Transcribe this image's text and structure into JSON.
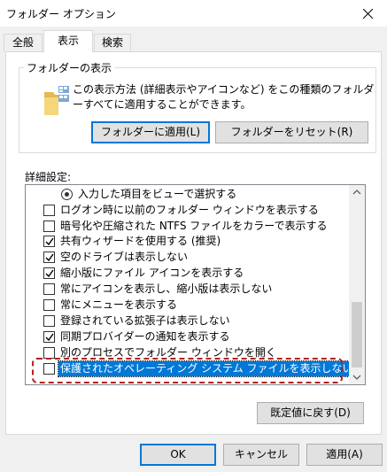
{
  "window": {
    "title": "フォルダー オプション",
    "close_glyph": "✕"
  },
  "tabs": [
    {
      "label": "全般",
      "active": false
    },
    {
      "label": "表示",
      "active": true
    },
    {
      "label": "検索",
      "active": false
    }
  ],
  "folder_view": {
    "legend": "フォルダーの表示",
    "description": "この表示方法 (詳細表示やアイコンなど) をこの種類のフォルダーすべてに適用することができます。",
    "apply_button": "フォルダーに適用(L)",
    "reset_button": "フォルダーをリセット(R)"
  },
  "advanced": {
    "label": "詳細設定:",
    "items": [
      {
        "type": "radio",
        "label": "入力した項目をビューで選択する",
        "checked": true
      },
      {
        "type": "checkbox",
        "label": "ログオン時に以前のフォルダー ウィンドウを表示する",
        "checked": false
      },
      {
        "type": "checkbox",
        "label": "暗号化や圧縮された NTFS ファイルをカラーで表示する",
        "checked": false
      },
      {
        "type": "checkbox",
        "label": "共有ウィザードを使用する (推奨)",
        "checked": true
      },
      {
        "type": "checkbox",
        "label": "空のドライブは表示しない",
        "checked": true
      },
      {
        "type": "checkbox",
        "label": "縮小版にファイル アイコンを表示する",
        "checked": true
      },
      {
        "type": "checkbox",
        "label": "常にアイコンを表示し、縮小版は表示しない",
        "checked": false
      },
      {
        "type": "checkbox",
        "label": "常にメニューを表示する",
        "checked": false
      },
      {
        "type": "checkbox",
        "label": "登録されている拡張子は表示しない",
        "checked": false
      },
      {
        "type": "checkbox",
        "label": "同期プロバイダーの通知を表示する",
        "checked": true
      },
      {
        "type": "checkbox",
        "label": "別のプロセスでフォルダー ウィンドウを開く",
        "checked": false
      },
      {
        "type": "checkbox",
        "label": "保護されたオペレーティング システム ファイルを表示しない (推奨)",
        "checked": false,
        "selected": true
      }
    ],
    "restore_defaults_button": "既定値に戻す(D)"
  },
  "footer": {
    "ok": "OK",
    "cancel": "キャンセル",
    "apply": "適用(A)"
  },
  "colors": {
    "selection": "#0078d7",
    "annotation": "#b22222",
    "folder": "#f5d67b"
  }
}
